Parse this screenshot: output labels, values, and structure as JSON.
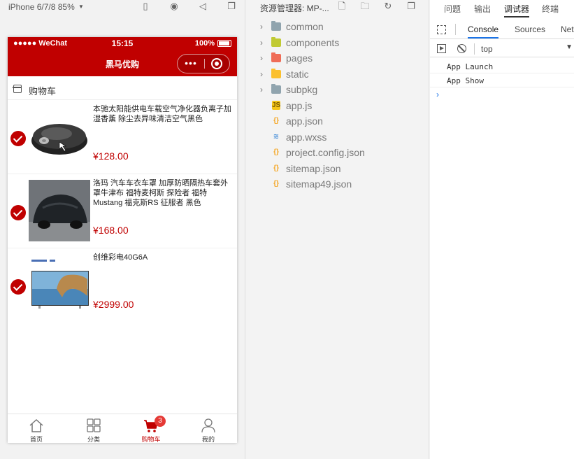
{
  "simulator": {
    "device": "iPhone 6/7/8 85%",
    "icons": [
      "phone-icon",
      "record-icon",
      "volume-icon",
      "window-icon"
    ]
  },
  "phone": {
    "status": {
      "carrier": "●●●●● WeChat",
      "time": "15:15",
      "battery": "100%"
    },
    "nav_title": "黑马优购",
    "capsule_more": "•••",
    "cart_header": "购物车",
    "items": [
      {
        "name": "本驰太阳能供电车载空气净化器负离子加湿香薰 除尘去异味清洁空气黑色",
        "price": "¥128.00",
        "checked": true,
        "image": "air-purifier"
      },
      {
        "name": "洛玛 汽车车衣车罩 加厚防晒隔热车套外罩牛津布 福特麦柯斯 探险者 福特Mustang 福克斯RS 征服者 黑色",
        "price": "¥168.00",
        "checked": true,
        "image": "car-cover"
      },
      {
        "name": "创维彩电40G6A",
        "price": "¥2999.00",
        "checked": true,
        "image": "television"
      }
    ],
    "tabs": [
      {
        "label": "首页",
        "icon": "home-icon",
        "active": false
      },
      {
        "label": "分类",
        "icon": "category-icon",
        "active": false
      },
      {
        "label": "购物车",
        "icon": "cart-icon",
        "active": true,
        "badge": "3"
      },
      {
        "label": "我的",
        "icon": "user-icon",
        "active": false
      }
    ],
    "accent": "#c00000"
  },
  "explorer": {
    "title": "资源管理器: MP-...",
    "items": [
      {
        "label": "common",
        "type": "folder",
        "color": "#90a4ae"
      },
      {
        "label": "components",
        "type": "folder",
        "color": "#c0ca33"
      },
      {
        "label": "pages",
        "type": "folder",
        "color": "#ef6c57"
      },
      {
        "label": "static",
        "type": "folder",
        "color": "#fbc02d"
      },
      {
        "label": "subpkg",
        "type": "folder",
        "color": "#90a4ae"
      },
      {
        "label": "app.js",
        "type": "js"
      },
      {
        "label": "app.json",
        "type": "json"
      },
      {
        "label": "app.wxss",
        "type": "css"
      },
      {
        "label": "project.config.json",
        "type": "json"
      },
      {
        "label": "sitemap.json",
        "type": "json"
      },
      {
        "label": "sitemap49.json",
        "type": "json"
      }
    ]
  },
  "devtools": {
    "tabs": [
      "问题",
      "输出",
      "调试器",
      "终端"
    ],
    "subtabs": [
      "Console",
      "Sources",
      "Net"
    ],
    "context": "top",
    "logs": [
      "App Launch",
      "App Show"
    ],
    "prompt": "›"
  }
}
